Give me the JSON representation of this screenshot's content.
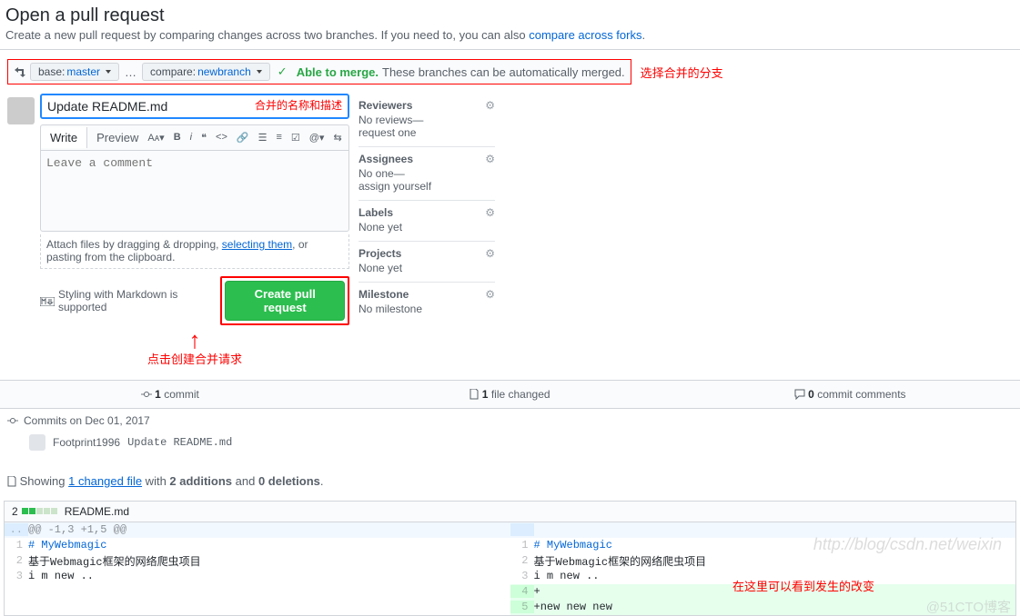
{
  "header": {
    "title": "Open a pull request",
    "subtitle_pre": "Create a new pull request by comparing changes across two branches. If you need to, you can also ",
    "subtitle_link": "compare across forks",
    "subtitle_post": "."
  },
  "compare": {
    "base_label": "base: ",
    "base_value": "master",
    "compare_label": "compare: ",
    "compare_value": "newbranch",
    "able": "Able to merge.",
    "note": "These branches can be automatically merged."
  },
  "annotations": {
    "branch_ann": "选择合并的分支",
    "title_ann": "合并的名称和描述",
    "create_ann": "点击创建合并请求",
    "diff_ann": "在这里可以看到发生的改变",
    "watermark": "http://blog/csdn.net/weixin",
    "watermark2": "@51CTO博客"
  },
  "editor": {
    "pr_title": "Update README.md",
    "tab_write": "Write",
    "tab_preview": "Preview",
    "placeholder": "Leave a comment",
    "attach1": "Attach files by dragging & dropping, ",
    "attach_link": "selecting them",
    "attach2": ", or pasting from the clipboard.",
    "md_support": "Styling with Markdown is supported",
    "create_btn": "Create pull request"
  },
  "sidebar": {
    "reviewers": {
      "title": "Reviewers",
      "l1": "No reviews—",
      "l2": "request one"
    },
    "assignees": {
      "title": "Assignees",
      "l1": "No one—",
      "l2": "assign yourself"
    },
    "labels": {
      "title": "Labels",
      "l1": "None yet"
    },
    "projects": {
      "title": "Projects",
      "l1": "None yet"
    },
    "milestone": {
      "title": "Milestone",
      "l1": "No milestone"
    }
  },
  "stats": {
    "commits_n": "1",
    "commits_t": "commit",
    "files_n": "1",
    "files_t": "file changed",
    "comments_n": "0",
    "comments_t": "commit comments"
  },
  "commits": {
    "day": "Commits on Dec 01, 2017",
    "author": "Footprint1996",
    "msg": "Update README.md"
  },
  "showing": {
    "pre": "Showing ",
    "link": "1 changed file",
    "mid": " with ",
    "add": "2 additions",
    "and": " and ",
    "del": "0 deletions",
    "post": "."
  },
  "file": {
    "stats_n": "2",
    "name": "README.md",
    "hunk": "@@ -1,3 +1,5 @@",
    "l1": "# MyWebmagic",
    "l2": "基于Webmagic框架的网络爬虫项目",
    "l3": "i m new ..",
    "l4": "+",
    "l5": "+new new new"
  }
}
